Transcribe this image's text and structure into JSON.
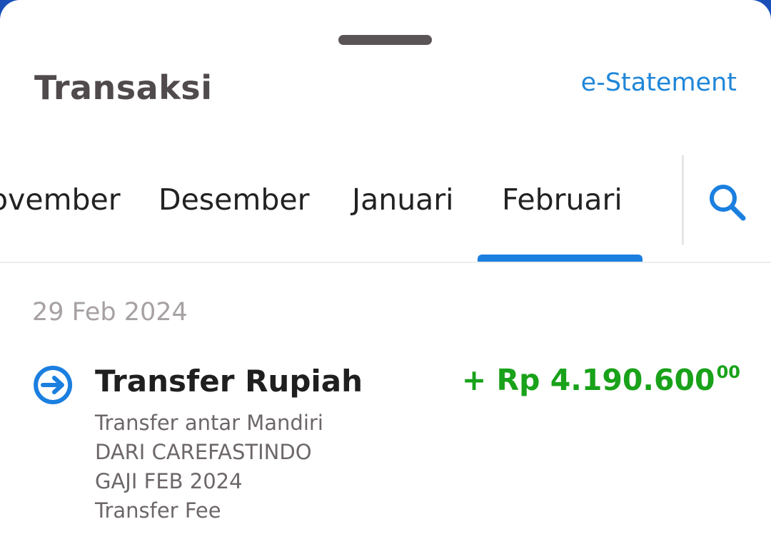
{
  "sheet": {
    "title": "Transaksi",
    "estatement_label": "e-Statement"
  },
  "month_tabs": {
    "items": [
      {
        "label": "November",
        "visible_text": "ovember"
      },
      {
        "label": "Desember"
      },
      {
        "label": "Januari"
      },
      {
        "label": "Februari",
        "selected": true
      }
    ],
    "search_icon": "search-icon"
  },
  "transactions": {
    "date": "29 Feb 2024",
    "items": [
      {
        "icon": "transfer-in-icon",
        "title": "Transfer Rupiah",
        "amount_main": "+ Rp 4.190.600",
        "amount_cents": "00",
        "details": [
          "Transfer antar Mandiri",
          "DARI CAREFASTINDO",
          "GAJI FEB 2024",
          "Transfer Fee"
        ]
      }
    ]
  },
  "colors": {
    "accent": "#1b7fe0",
    "link": "#1f86d8",
    "amount_credit": "#19a21a",
    "title": "#504a4c",
    "backdrop": "#1a4fb8"
  }
}
